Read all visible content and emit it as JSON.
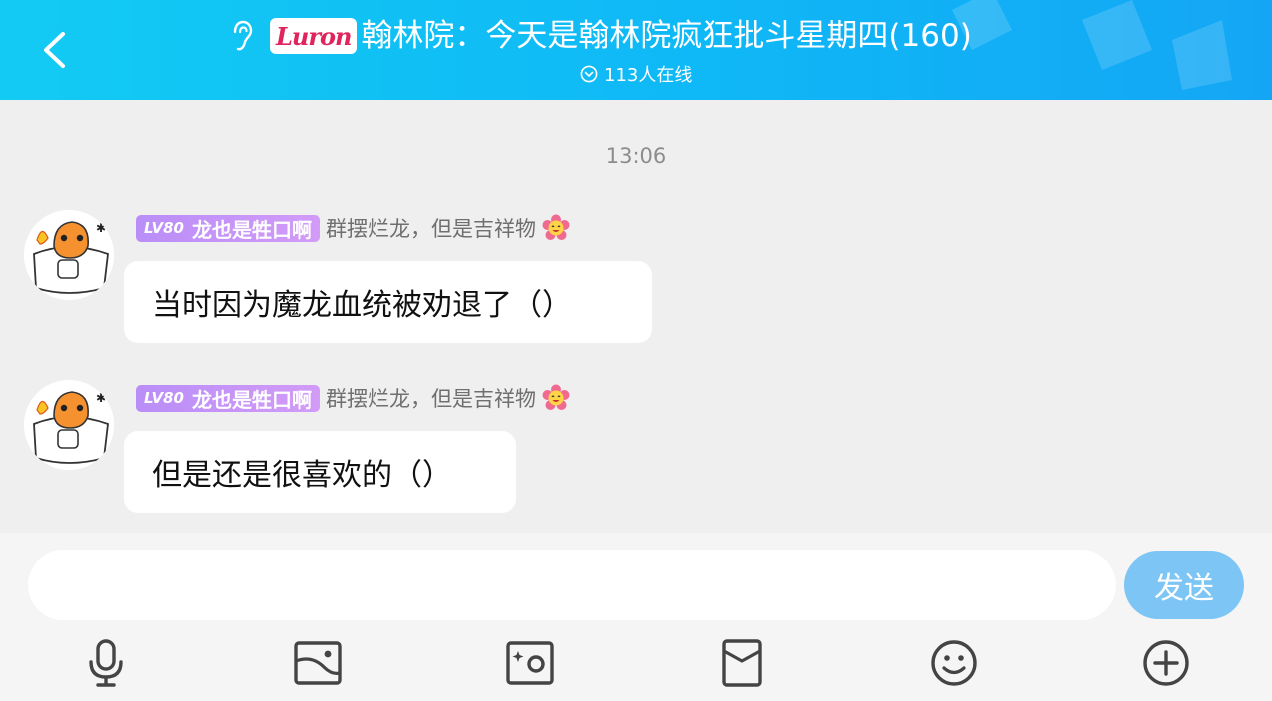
{
  "header": {
    "brand_badge": "Luron",
    "title": "翰林院：今天是翰林院疯狂批斗星期四(160)",
    "online_text": "113人在线",
    "gradient_start": "#12cbf3",
    "gradient_end": "#14a6f5"
  },
  "chat": {
    "timestamp": "13:06",
    "messages": [
      {
        "level": "LV80",
        "nickname": "龙也是牲口啊",
        "member_title": "群摆烂龙，但是吉祥物",
        "text": "当时因为魔龙血统被劝退了（）"
      },
      {
        "level": "LV80",
        "nickname": "龙也是牲口啊",
        "member_title": "群摆烂龙，但是吉祥物",
        "text": "但是还是很喜欢的（）"
      }
    ]
  },
  "composer": {
    "input_value": "",
    "send_label": "发送",
    "send_color": "#7cc5f4"
  },
  "toolbar": {
    "icons": [
      "microphone-icon",
      "photo-icon",
      "camera-icon",
      "red-packet-icon",
      "emoji-icon",
      "plus-icon"
    ]
  }
}
